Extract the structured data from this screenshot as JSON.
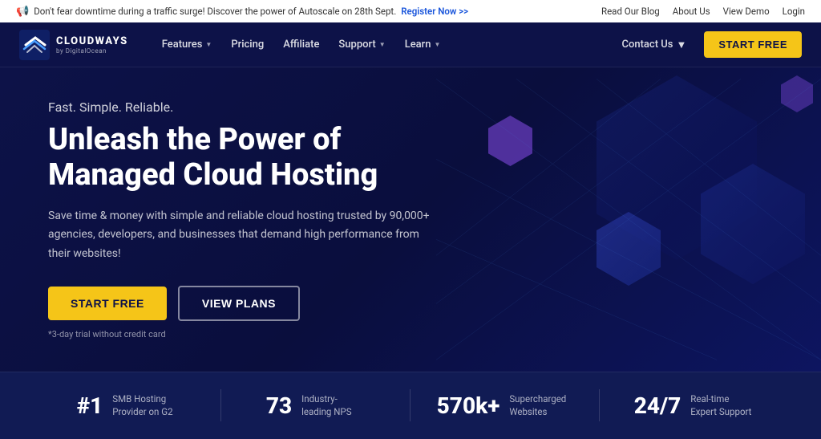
{
  "announcement": {
    "text": "Don't fear downtime during a traffic surge! Discover the power of Autoscale on 28th Sept.",
    "cta": "Register Now >>",
    "links": [
      "Read Our Blog",
      "About Us",
      "View Demo",
      "Login"
    ]
  },
  "navbar": {
    "logo": {
      "name": "CLOUDWAYS",
      "sub": "by DigitalOcean"
    },
    "nav_items": [
      {
        "label": "Features",
        "has_dropdown": true
      },
      {
        "label": "Pricing",
        "has_dropdown": false
      },
      {
        "label": "Affiliate",
        "has_dropdown": false
      },
      {
        "label": "Support",
        "has_dropdown": true
      },
      {
        "label": "Learn",
        "has_dropdown": true
      }
    ],
    "contact_us": "Contact Us",
    "start_free": "START FREE"
  },
  "hero": {
    "tagline": "Fast. Simple. Reliable.",
    "title": "Unleash the Power of\nManaged Cloud Hosting",
    "description": "Save time & money with simple and reliable cloud hosting trusted by 90,000+ agencies, developers, and businesses that demand high performance from their websites!",
    "btn_start": "START FREE",
    "btn_plans": "VIEW PLANS",
    "trial_note": "*3-day trial without credit card"
  },
  "stats": [
    {
      "number": "#1",
      "desc": "SMB Hosting Provider on G2"
    },
    {
      "number": "73",
      "desc": "Industry-leading NPS"
    },
    {
      "number": "570k+",
      "desc": "Supercharged Websites"
    },
    {
      "number": "24/7",
      "desc": "Real-time Expert Support"
    }
  ]
}
